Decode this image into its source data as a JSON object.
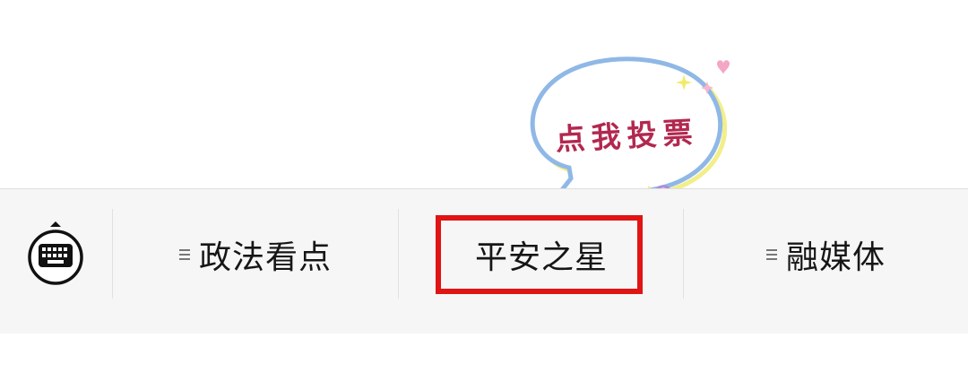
{
  "menu": {
    "keyboard_icon": "keyboard-icon",
    "items": [
      {
        "label": "政法看点",
        "has_submenu": true
      },
      {
        "label": "平安之星",
        "has_submenu": false,
        "highlighted": true
      },
      {
        "label": "融媒体",
        "has_submenu": true
      }
    ]
  },
  "bubble": {
    "text": "点我投票"
  },
  "colors": {
    "highlight_border": "#e01414",
    "bubble_text": "#b2284f",
    "bubble_outline_blue": "#8fb8e6",
    "bubble_outline_yellow": "#f2ee8a",
    "menu_background": "#f6f6f6"
  }
}
